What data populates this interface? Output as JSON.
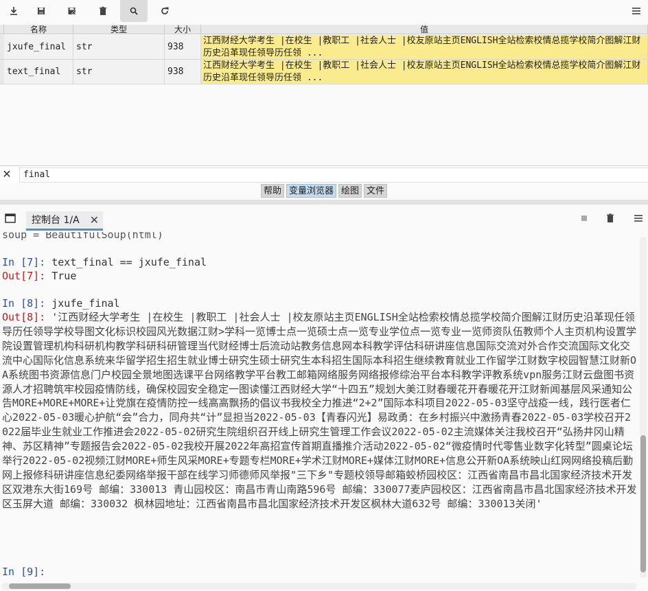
{
  "toolbar": {
    "icons": [
      "import-icon",
      "save-icon",
      "save-as-icon",
      "delete-icon",
      "search-icon",
      "refresh-icon",
      "hamburger-menu-icon"
    ]
  },
  "table": {
    "headers": [
      "名称",
      "类型",
      "大小",
      "值"
    ],
    "rows": [
      {
        "name": "jxufe_final",
        "type": "str",
        "size": "938",
        "value": "江西财经大学考生  |在校生  |教职工  |社会人士  |校友原站主页ENGLISH全站检索校情总揽学校简介图解江财历史沿革现任领导历任领 ..."
      },
      {
        "name": "text_final",
        "type": "str",
        "size": "938",
        "value": "江西财经大学考生  |在校生  |教职工  |社会人士  |校友原站主页ENGLISH全站检索校情总揽学校简介图解江财历史沿革现任领导历任领 ..."
      }
    ]
  },
  "filter": {
    "close": "✕",
    "value": "final"
  },
  "pane_tabs": [
    {
      "label": "帮助",
      "active": false
    },
    {
      "label": "变量浏览器",
      "active": true
    },
    {
      "label": "绘图",
      "active": false
    },
    {
      "label": "文件",
      "active": false
    }
  ],
  "console": {
    "tab_label": "控制台 1/A",
    "tab_close": "✕",
    "lines": {
      "partial": "soup = BeautifulSoup(html)",
      "in7": "In [7]:",
      "in7_code": " text_final == jxufe_final",
      "out7": "Out[7]:",
      "out7_val": " True",
      "in8": "In [8]:",
      "in8_code": " jxufe_final",
      "out8": "Out[8]:",
      "in9": "In [9]:"
    },
    "out8_text": "'江西财经大学考生  |在校生  |教职工  |社会人士  |校友原站主页ENGLISH全站检索校情总揽学校简介图解江财历史沿革现任领导历任领导学校导图文化标识校园风光数据江财>学科一览博士点一览硕士点一览专业学位点一览专业一览师资队伍教师个人主页机构设置学院设置管理机构科研机构教学科研科研管理当代财经博士后流动站教务信息网本科教学评估科研讲座信息国际交流对外合作交流国际文化交流中心国际化信息系统来华留学招生招生就业博士研究生硕士研究生本科招生国际本科招生继续教育就业工作留学江财数字校园智慧江财新OA系统图书资源信息门户校园全景地图选课平台网络教学平台教工邮箱网络服务网络报修综治平台本科教学评教系统vpn服务江财云盘图书资源人才招聘筑牢校园疫情防线，确保校园安全稳定一图读懂江西财经大学“十四五”规划大美江财春暖花开春暖花开江财新闻基层风采通知公告MORE+MORE+MORE+让党旗在疫情防控一线高高飘扬的倡议书我校全力推进“2+2”国际本科项目2022-05-03坚守战疫一线，践行医者仁心2022-05-03暖心护航“会”合力，同舟共“计”显担当2022-05-03【青春闪光】易政勇：在乡村振兴中激扬青春2022-05-03学校召开2022届毕业生就业工作推进会2022-05-02研究生院组织召开线上研究生管理工作会议2022-05-02主流媒体关注我校召开“弘扬井冈山精神、苏区精神”专题报告会2022-05-02我校开展2022年高招宣传首期直播推介活动2022-05-02“微疫情时代零售业数字化转型”圆桌论坛举行2022-05-02视频江财MORE+师生风采MORE+专题专栏MORE+学术江财MORE+媒体江财MORE+信息公开新OA系统映山红网网络投稿后勤网上报修科研讲座信息纪委网络举报干部在线学习师德师风举报\"三下乡\"专题校领导邮箱蛟桥园校区：江西省南昌市昌北国家经济技术开发区双港东大街169号  邮编：330013 青山园校区：南昌市青山南路596号  邮编：330077麦庐园校区：江西省南昌市昌北国家经济技术开发区玉屏大道 邮编：330032 枫林园地址：江西省南昌市昌北国家经济技术开发区枫林大道632号 邮编：330013关闭'"
  },
  "colors": {
    "value_highlight": "#fbeb8f",
    "prompt_in": "#2a4fa0",
    "prompt_out": "#b22222",
    "tab_underline": "#4a90d9"
  }
}
